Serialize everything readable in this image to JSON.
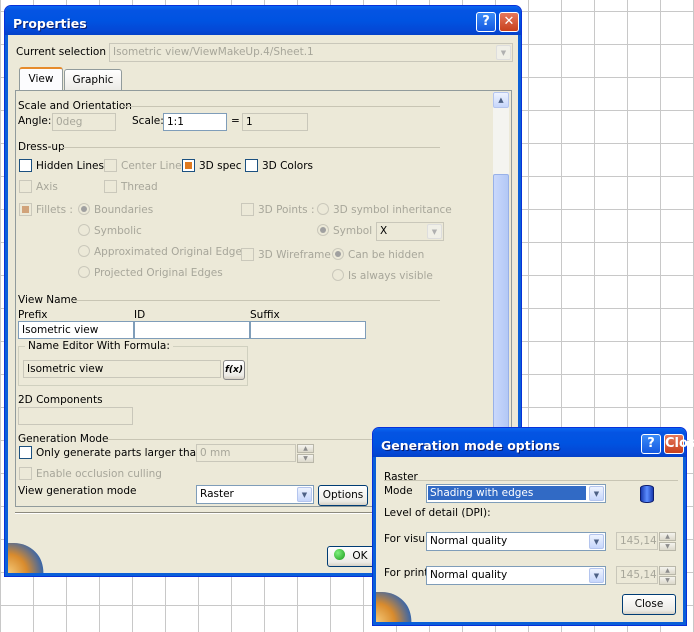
{
  "properties": {
    "title": "Properties",
    "help_btn": "?",
    "close_btn": "✕",
    "current_selection_label": "Current selection :",
    "current_selection_value": "Isometric view/ViewMakeUp.4/Sheet.1",
    "tabs": [
      "View",
      "Graphic"
    ],
    "scale_orientation": {
      "heading": "Scale and Orientation",
      "angle_label": "Angle:",
      "angle_value": "0deg",
      "scale_label": "Scale:",
      "scale_value": "1:1",
      "equals": "=",
      "scale_result": "1"
    },
    "dressup": {
      "heading": "Dress-up",
      "hidden_lines": "Hidden Lines",
      "center_line": "Center Line",
      "spec3d": "3D spec",
      "colors3d": "3D Colors",
      "axis": "Axis",
      "thread": "Thread",
      "fillets": "Fillets :",
      "boundaries": "Boundaries",
      "symbolic": "Symbolic",
      "approx_edges": "Approximated Original Edges",
      "proj_edges": "Projected Original Edges",
      "points3d": "3D Points :",
      "symbol_inheritance": "3D symbol inheritance",
      "symbol": "Symbol",
      "symbol_value": "X",
      "wireframe3d": "3D Wireframe",
      "can_be_hidden": "Can be hidden",
      "always_visible": "Is always visible"
    },
    "view_name": {
      "heading": "View Name",
      "prefix": "Prefix",
      "id": "ID",
      "suffix": "Suffix",
      "prefix_value": "Isometric view",
      "name_editor_label": "Name Editor With Formula:",
      "name_editor_value": "Isometric view",
      "formula_btn": "f(x)"
    },
    "components2d": {
      "heading": "2D Components"
    },
    "generation": {
      "heading": "Generation Mode",
      "only_generate": "Only generate parts larger than",
      "size_value": "0 mm",
      "occlusion": "Enable occlusion culling",
      "view_gen_mode": "View generation mode",
      "mode_value": "Raster",
      "options_btn": "Options"
    },
    "ok_btn": "OK"
  },
  "gen_options": {
    "title": "Generation mode options",
    "help_btn": "?",
    "close_btn": "Close",
    "raster": "Raster",
    "mode_label": "Mode",
    "mode_value": "Shading with edges",
    "level_label": "Level of detail (DPI):",
    "for_visu": "For visu",
    "visu_value": "Normal quality",
    "visu_dpi": "145,14",
    "for_print": "For print",
    "print_value": "Normal quality",
    "print_dpi": "145,14"
  }
}
